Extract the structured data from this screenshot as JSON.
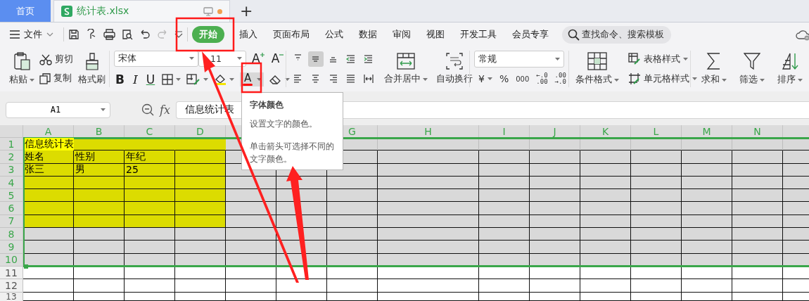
{
  "tabs": [
    {
      "label": "首页",
      "selected": false,
      "modified": false
    },
    {
      "label": "统计表.xlsx",
      "selected": true,
      "modified": true
    }
  ],
  "new_tab": "+",
  "menu": {
    "file": "文件",
    "ribbon_tabs": [
      {
        "label": "开始",
        "selected": true
      },
      {
        "label": "插入",
        "selected": false
      },
      {
        "label": "页面布局",
        "selected": false
      },
      {
        "label": "公式",
        "selected": false
      },
      {
        "label": "数据",
        "selected": false
      },
      {
        "label": "审阅",
        "selected": false
      },
      {
        "label": "视图",
        "selected": false
      },
      {
        "label": "开发工具",
        "selected": false
      },
      {
        "label": "会员专享",
        "selected": false
      }
    ],
    "search": {
      "placeholder": "查找命令、搜索模板"
    }
  },
  "ribbon": {
    "clipboard": {
      "paste": "粘贴",
      "cut": "剪切",
      "copy": "复制",
      "format_painter": "格式刷"
    },
    "font": {
      "name": "宋体",
      "size": "11",
      "grow": "A",
      "shrink": "A",
      "bold": "B",
      "italic": "I",
      "underline": "U",
      "font_color": "A"
    },
    "alignment": [
      {
        "selected": false
      },
      {
        "selected": true
      },
      {
        "selected": false
      },
      {
        "selected": false
      },
      {
        "selected": false
      },
      {
        "selected": false
      },
      {
        "selected": false
      },
      {
        "selected": false
      },
      {
        "selected": false
      },
      {
        "selected": false
      }
    ],
    "merge": "合并居中",
    "wrap": "自动换行",
    "number": {
      "format": "常规",
      "currency": "¥",
      "percent": "%",
      "thousands": "000",
      "add_decimal": [
        "←.0",
        ".00"
      ],
      "remove_decimal": [
        ".00",
        "→.0"
      ]
    },
    "styles": {
      "conditional": "条件格式",
      "table_style": "表格样式",
      "cell_style": "单元格样式"
    },
    "editing": [
      "求和",
      "筛选",
      "排序"
    ]
  },
  "formula": {
    "name_box": "A1",
    "fx": "fx",
    "value": "信息统计表"
  },
  "tooltip": {
    "title": "字体颜色",
    "lines": [
      "设置文字的颜色。",
      "单击箭头可选择不同的文字颜色。"
    ]
  },
  "grid": {
    "columns": [
      {
        "label": "A",
        "selected": true
      },
      {
        "label": "B",
        "selected": true
      },
      {
        "label": "C",
        "selected": true
      },
      {
        "label": "D",
        "selected": true
      },
      {
        "selected": true
      },
      {},
      {
        "label": "G",
        "selected": true
      },
      {
        "label": "H",
        "selected": true
      },
      {
        "label": "I",
        "selected": true
      },
      {
        "label": "J",
        "selected": true
      },
      {
        "label": "K",
        "selected": true
      },
      {
        "label": "L",
        "selected": true
      },
      {
        "label": "M",
        "selected": true
      },
      {
        "label": "N",
        "selected": true
      },
      {
        "selected": true
      }
    ],
    "rows": [
      {
        "number": "1",
        "kind": "title",
        "selected": true,
        "highlighted": true,
        "cells": [
          "信息统计表"
        ]
      },
      {
        "number": "2",
        "kind": "data",
        "selected": true,
        "highlighted": true,
        "cells": [
          "姓名",
          "性别",
          "年纪"
        ]
      },
      {
        "number": "3",
        "kind": "data",
        "selected": true,
        "highlighted": true,
        "cells": [
          "张三",
          "男",
          "25"
        ]
      },
      {
        "number": "4",
        "kind": "data",
        "selected": true,
        "highlighted": true
      },
      {
        "number": "5",
        "kind": "data",
        "selected": true,
        "highlighted": true
      },
      {
        "number": "6",
        "kind": "data",
        "selected": true,
        "highlighted": true
      },
      {
        "number": "7",
        "kind": "data",
        "selected": true,
        "highlighted": true
      },
      {
        "number": "8",
        "kind": "data",
        "selected": true,
        "highlighted": false
      },
      {
        "number": "9",
        "kind": "data",
        "selected": true,
        "highlighted": false
      },
      {
        "number": "10",
        "kind": "data",
        "selected": true,
        "highlighted": false
      },
      {
        "number": "11",
        "kind": "data",
        "selected": false,
        "highlighted": false
      },
      {
        "number": "12",
        "kind": "data",
        "selected": false,
        "highlighted": false
      },
      {
        "number": "13",
        "kind": "data",
        "selected": false,
        "highlighted": false
      }
    ]
  }
}
